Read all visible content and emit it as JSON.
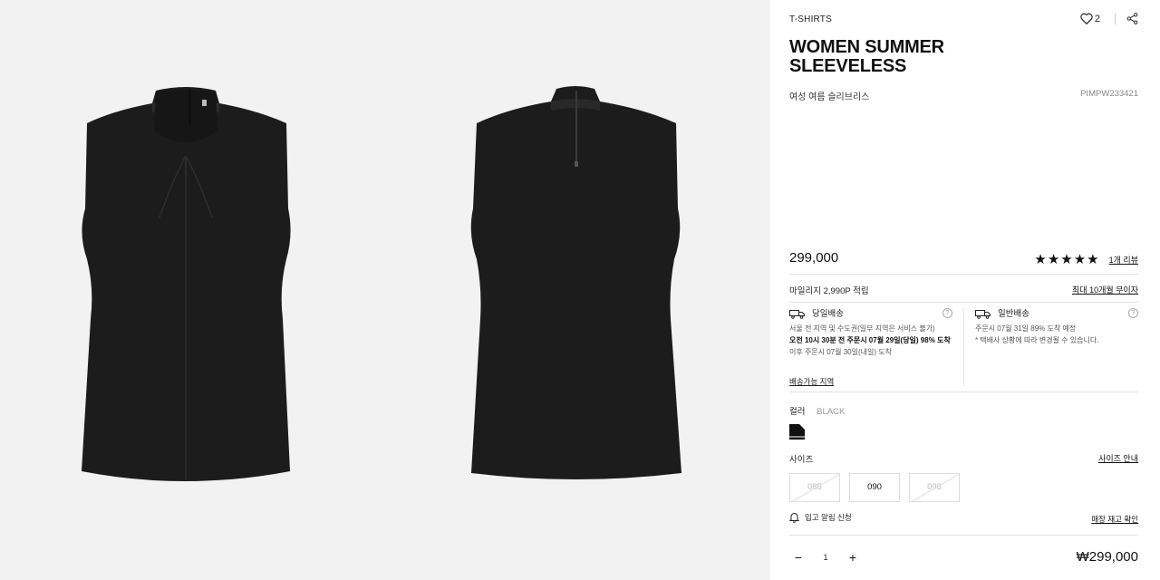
{
  "product": {
    "category": "T-SHIRTS",
    "like_count": "2",
    "title": "WOMEN SUMMER SLEEVELESS",
    "subname": "여성 여름 슬리브리스",
    "code": "PIMPW233421",
    "price": "299,000",
    "stars": "★★★★★",
    "review_link": "1개 리뷰"
  },
  "benefits": {
    "mileage": "마일리지 2,990P 적립",
    "installment_link": "최대 10개월 무이자"
  },
  "shipping": {
    "same_day": {
      "title": "당일배송",
      "line1": "서울 전 지역 및 수도권(일부 지역은 서비스 불가)",
      "line2": "오전 10시 30분 전 주문시 07월 29일(당일) 98% 도착",
      "line3": "이후 주문시 07월 30일(내일) 도착"
    },
    "standard": {
      "title": "일반배송",
      "line1": "주문시 07월 31일 89% 도착 예정",
      "line2": "* 택배사 상황에 따라 변경될 수 있습니다."
    },
    "area_link": "배송가능 지역",
    "help_glyph": "?"
  },
  "options": {
    "color_label": "컬러",
    "color_value": "BLACK",
    "swatch_color": "#111111",
    "size_label": "사이즈",
    "size_guide": "사이즈 안내",
    "sizes": [
      "085",
      "090",
      "095"
    ]
  },
  "actions": {
    "restock_alert": "입고 알림 신청",
    "store_stock": "매장 재고 확인"
  },
  "cart": {
    "minus": "−",
    "qty": "1",
    "plus": "+",
    "total": "₩299,000"
  }
}
